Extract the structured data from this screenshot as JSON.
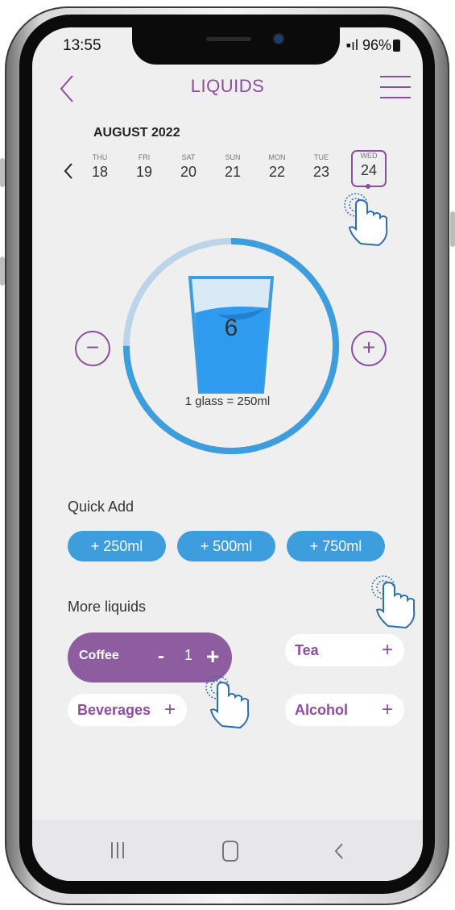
{
  "status": {
    "time": "13:55",
    "battery": "96%"
  },
  "header": {
    "title": "LIQUIDS"
  },
  "calendar": {
    "month": "AUGUST 2022",
    "days": [
      {
        "dow": "THU",
        "num": "18"
      },
      {
        "dow": "FRI",
        "num": "19"
      },
      {
        "dow": "SAT",
        "num": "20"
      },
      {
        "dow": "SUN",
        "num": "21"
      },
      {
        "dow": "MON",
        "num": "22"
      },
      {
        "dow": "TUE",
        "num": "23"
      },
      {
        "dow": "WED",
        "num": "24"
      }
    ],
    "selected": "24"
  },
  "tracker": {
    "count": "6",
    "glass_label": "1 glass = 250ml",
    "minus": "−",
    "plus": "+",
    "progress": 0.75
  },
  "quick_add": {
    "label": "Quick Add",
    "options": [
      "+ 250ml",
      "+ 500ml",
      "+ 750ml"
    ]
  },
  "more_liquids": {
    "label": "More liquids",
    "coffee": {
      "label": "Coffee",
      "minus": "-",
      "qty": "1",
      "plus": "+"
    },
    "tea": {
      "label": "Tea",
      "plus": "+"
    },
    "beverages": {
      "label": "Beverages",
      "plus": "+"
    },
    "alcohol": {
      "label": "Alcohol",
      "plus": "+"
    }
  },
  "colors": {
    "accent": "#8d4d9e",
    "water": "#3e9ddc",
    "ring_light": "#bcd4ea"
  }
}
